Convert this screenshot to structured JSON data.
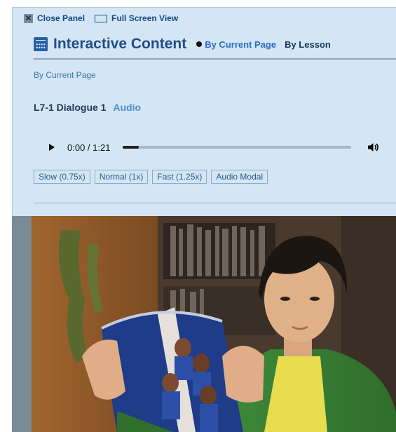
{
  "topbar": {
    "close_label": "Close Panel",
    "fullscreen_label": "Full Screen View"
  },
  "header": {
    "title": "Interactive Content",
    "tabs": [
      {
        "label": "By Current Page",
        "selected": true
      },
      {
        "label": "By Lesson",
        "selected": false
      }
    ]
  },
  "section": {
    "label": "By Current Page"
  },
  "lesson": {
    "title": "L7-1 Dialogue 1",
    "link": "Audio"
  },
  "player": {
    "time": "0:00 / 1:21",
    "progress_fraction": 0.07
  },
  "speed_buttons": [
    {
      "label": "Slow (0.75x)"
    },
    {
      "label": "Normal (1x)"
    },
    {
      "label": "Fast (1.25x)"
    },
    {
      "label": "Audio Modal"
    }
  ],
  "icons": {
    "close": "close-icon",
    "fullscreen": "fullscreen-icon",
    "calendar": "calendar-icon",
    "play": "play-icon",
    "volume": "volume-icon"
  },
  "colors": {
    "panel_bg": "#d4e6f4",
    "title": "#1f4d89",
    "accent": "#2b6cc2"
  }
}
